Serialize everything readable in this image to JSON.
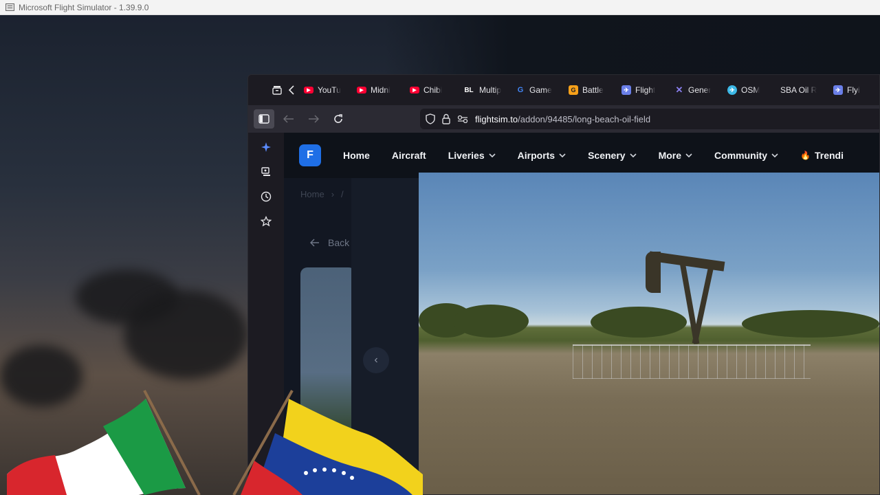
{
  "app": {
    "title": "Microsoft Flight Simulator - 1.39.9.0"
  },
  "browser": {
    "tabs": [
      {
        "label": "YouTu",
        "icon": "youtube-icon",
        "color": "#ff0033"
      },
      {
        "label": "Midni",
        "icon": "youtube-icon",
        "color": "#ff0033"
      },
      {
        "label": "Chibi",
        "icon": "youtube-icon",
        "color": "#ff0033"
      },
      {
        "label": "Multip",
        "icon": "bl-icon",
        "color": "#ffffff"
      },
      {
        "label": "Game",
        "icon": "google-icon",
        "color": "#4285f4"
      },
      {
        "label": "Battle",
        "icon": "battle-icon",
        "color": "#f6a019"
      },
      {
        "label": "Flight",
        "icon": "flight-icon",
        "color": "#6a7fe8"
      },
      {
        "label": "Gener",
        "icon": "general-icon",
        "color": "#8a7ff0"
      },
      {
        "label": "OSM",
        "icon": "osm-icon",
        "color": "#3cb8e6"
      },
      {
        "label": "SBA Oil R",
        "icon": "",
        "color": ""
      },
      {
        "label": "Flyi",
        "icon": "flight-icon",
        "color": "#6a7fe8"
      }
    ],
    "url": {
      "domain": "flightsim.to",
      "path": "/addon/94485/long-beach-oil-field"
    }
  },
  "site": {
    "logo": "F",
    "nav": [
      {
        "label": "Home",
        "dropdown": false
      },
      {
        "label": "Aircraft",
        "dropdown": false
      },
      {
        "label": "Liveries",
        "dropdown": true
      },
      {
        "label": "Airports",
        "dropdown": true
      },
      {
        "label": "Scenery",
        "dropdown": true
      },
      {
        "label": "More",
        "dropdown": true
      },
      {
        "label": "Community",
        "dropdown": true
      },
      {
        "label": "Trendi",
        "dropdown": false
      }
    ],
    "breadcrumb": {
      "home": "Home",
      "sep": "›",
      "next": "/"
    },
    "back": "Back"
  },
  "colors": {
    "accent": "#1f6fe6",
    "trending": "#ff4d3a"
  }
}
